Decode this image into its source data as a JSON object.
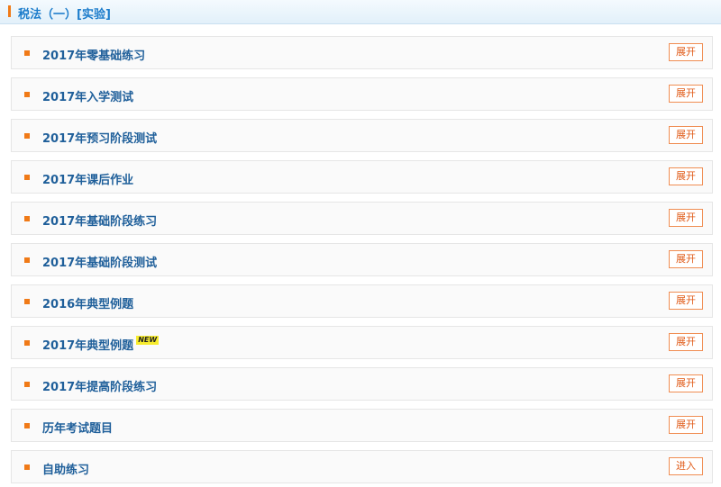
{
  "header": {
    "title": "税法（一）[实验]"
  },
  "items": [
    {
      "label": "2017年零基础练习",
      "button": "展开"
    },
    {
      "label": "2017年入学测试",
      "button": "展开"
    },
    {
      "label": "2017年预习阶段测试",
      "button": "展开"
    },
    {
      "label": "2017年课后作业",
      "button": "展开"
    },
    {
      "label": "2017年基础阶段练习",
      "button": "展开"
    },
    {
      "label": "2017年基础阶段测试",
      "button": "展开"
    },
    {
      "label": "2016年典型例题",
      "button": "展开"
    },
    {
      "label": "2017年典型例题",
      "button": "展开",
      "badge": "NEW"
    },
    {
      "label": "2017年提高阶段练习",
      "button": "展开"
    },
    {
      "label": "历年考试题目",
      "button": "展开"
    },
    {
      "label": "自助练习",
      "button": "进入"
    }
  ],
  "colors": {
    "accent": "#f07a17",
    "title": "#1c7ccb",
    "label": "#1f5f9a",
    "button_border": "#f08d52"
  }
}
